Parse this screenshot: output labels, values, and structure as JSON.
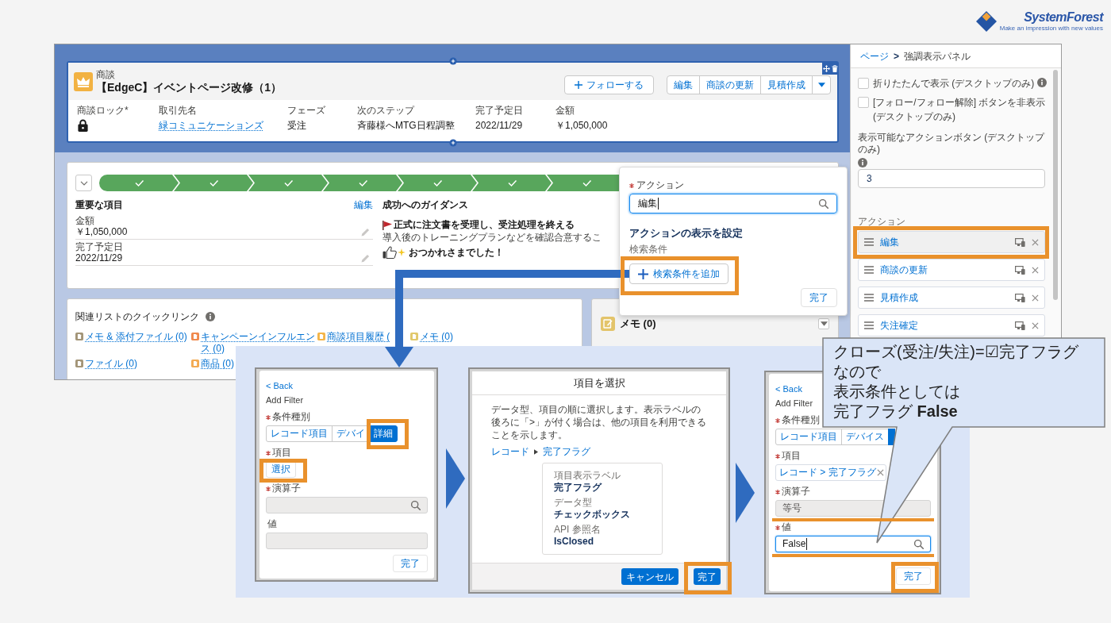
{
  "logo": {
    "name": "SystemForest",
    "tagline": "Make an impression with new values"
  },
  "record_page": {
    "header": {
      "object_label": "商談",
      "title": "【EdgeC】イベントページ改修（1）",
      "follow_button": "フォローする",
      "actions": [
        "編集",
        "商談の更新",
        "見積作成"
      ],
      "fields": [
        {
          "label": "商談ロック*",
          "kind": "lock"
        },
        {
          "label": "取引先名",
          "kind": "link",
          "value": "緑コミュニケーションズ"
        },
        {
          "label": "フェーズ",
          "kind": "text",
          "value": "受注"
        },
        {
          "label": "次のステップ",
          "kind": "text",
          "value": "斉藤様へMTG日程調整"
        },
        {
          "label": "完了予定日",
          "kind": "text",
          "value": "2022/11/29"
        },
        {
          "label": "金額",
          "kind": "text",
          "value": "￥1,050,000"
        }
      ]
    },
    "path": {
      "stages": [
        {
          "complete": true
        },
        {
          "complete": true
        },
        {
          "complete": true
        },
        {
          "complete": true
        },
        {
          "complete": true
        },
        {
          "complete": true
        },
        {
          "complete": true
        }
      ]
    },
    "key_fields": {
      "title": "重要な項目",
      "edit_link": "編集",
      "fields": [
        {
          "label": "金額",
          "value": "￥1,050,000"
        },
        {
          "label": "完了予定日",
          "value": "2022/11/29"
        }
      ]
    },
    "guidance": {
      "title": "成功へのガイダンス",
      "heading": "正式に注文書を受理し、受注処理を終える",
      "text": "導入後のトレーニングプランなどを確認合意するこ",
      "closing": "おつかれさまでした！"
    },
    "related_quick_links": {
      "title": "関連リストのクイックリンク",
      "links": [
        {
          "label": "メモ & 添付ファイル (0)",
          "color": "#a39578"
        },
        {
          "label": "キャンペーンインフルエンス (0)",
          "color": "#f0894d"
        },
        {
          "label": "商談項目履歴 (",
          "color": "#f4b549"
        },
        {
          "label": "メモ (0)",
          "color": "#e1c86b"
        },
        {
          "label": "ファイル (0)",
          "color": "#a39578"
        },
        {
          "label": "商品 (0)",
          "color": "#f3aa52"
        }
      ]
    },
    "memo_card": {
      "title": "メモ (0)"
    }
  },
  "action_popover": {
    "label": "アクション",
    "required": true,
    "value": "編集",
    "focused": true,
    "section_title": "アクションの表示を設定",
    "filter_label": "検索条件",
    "add_filter_button": {
      "label": "検索条件を追加",
      "highlighted": true
    },
    "done_button": "完了"
  },
  "properties_panel": {
    "breadcrumb_link": "ページ",
    "separator": ">",
    "breadcrumb_current": "強調表示パネル",
    "options": [
      {
        "label": "折りたたんで表示 (デスクトップのみ)",
        "checked": false,
        "info": true
      },
      {
        "label": "[フォロー/フォロー解除] ボタンを非表示 (デスクトップのみ)",
        "checked": false,
        "info": false
      }
    ],
    "visible_actions": {
      "label": "表示可能なアクションボタン (デスクトップのみ)",
      "value": "3"
    },
    "actions_label": "アクション",
    "actions": [
      {
        "label": "編集",
        "selected": true,
        "highlighted": true
      },
      {
        "label": "商談の更新",
        "selected": false
      },
      {
        "label": "見積作成",
        "selected": false
      },
      {
        "label": "失注確定",
        "selected": false
      }
    ]
  },
  "steps": [
    {
      "kind": "filter",
      "back_link": "< Back",
      "title": "Add Filter",
      "fields": [
        {
          "kind": "segments",
          "label": "条件種別",
          "required": true,
          "segments": [
            {
              "label": "レコード項目",
              "selected": false
            },
            {
              "label": "デバイ",
              "selected": false
            },
            {
              "label": "詳細",
              "selected": true,
              "highlighted": true
            }
          ]
        },
        {
          "kind": "select_button",
          "label": "項目",
          "required": true,
          "value": "選択",
          "highlighted": true
        },
        {
          "kind": "input",
          "label": "演算子",
          "required": true,
          "disabled": true,
          "focused": false,
          "search_icon": true
        },
        {
          "kind": "input",
          "label": "値",
          "required": false,
          "disabled": true,
          "focused": false,
          "search_icon": false
        }
      ],
      "done_button": {
        "label": "完了"
      }
    },
    {
      "kind": "field_picker",
      "title": "項目を選択",
      "description": "データ型、項目の順に選択します。表示ラベルの後ろに「>」が付く場合は、他の項目を利用できることを示します。",
      "breadcrumb": [
        "レコード",
        "完了フラグ"
      ],
      "details": [
        {
          "label": "項目表示ラベル",
          "value": "完了フラグ"
        },
        {
          "label": "データ型",
          "value": "チェックボックス"
        },
        {
          "label": "API 参照名",
          "value": "IsClosed"
        }
      ],
      "cancel_button": {
        "label": "キャンセル"
      },
      "done_button": {
        "label": "完了",
        "highlighted": true
      }
    },
    {
      "kind": "filter",
      "back_link": "< Back",
      "title": "Add Filter",
      "fields": [
        {
          "kind": "segments",
          "label": "条件種別",
          "required": true,
          "segments": [
            {
              "label": "レコード項目",
              "selected": false
            },
            {
              "label": "デバイス",
              "selected": false
            },
            {
              "selected": true
            }
          ]
        },
        {
          "kind": "pill",
          "label": "項目",
          "required": true,
          "value": "レコード > 完了フラグ"
        },
        {
          "kind": "input",
          "label": "演算子",
          "required": true,
          "disabled": true,
          "focused": false,
          "value": "等号",
          "search_icon": false,
          "underlined": true
        },
        {
          "kind": "input",
          "label": "値",
          "required": true,
          "disabled": false,
          "focused": true,
          "value": "False",
          "search_icon": true,
          "underlined": true
        }
      ],
      "done_button": {
        "label": "完了",
        "highlighted": true
      }
    }
  ],
  "callout": {
    "lines": [
      "クローズ(受注/失注)=☑完了フラグ",
      "なので",
      "表示条件としては",
      "完了フラグ **False**"
    ]
  }
}
